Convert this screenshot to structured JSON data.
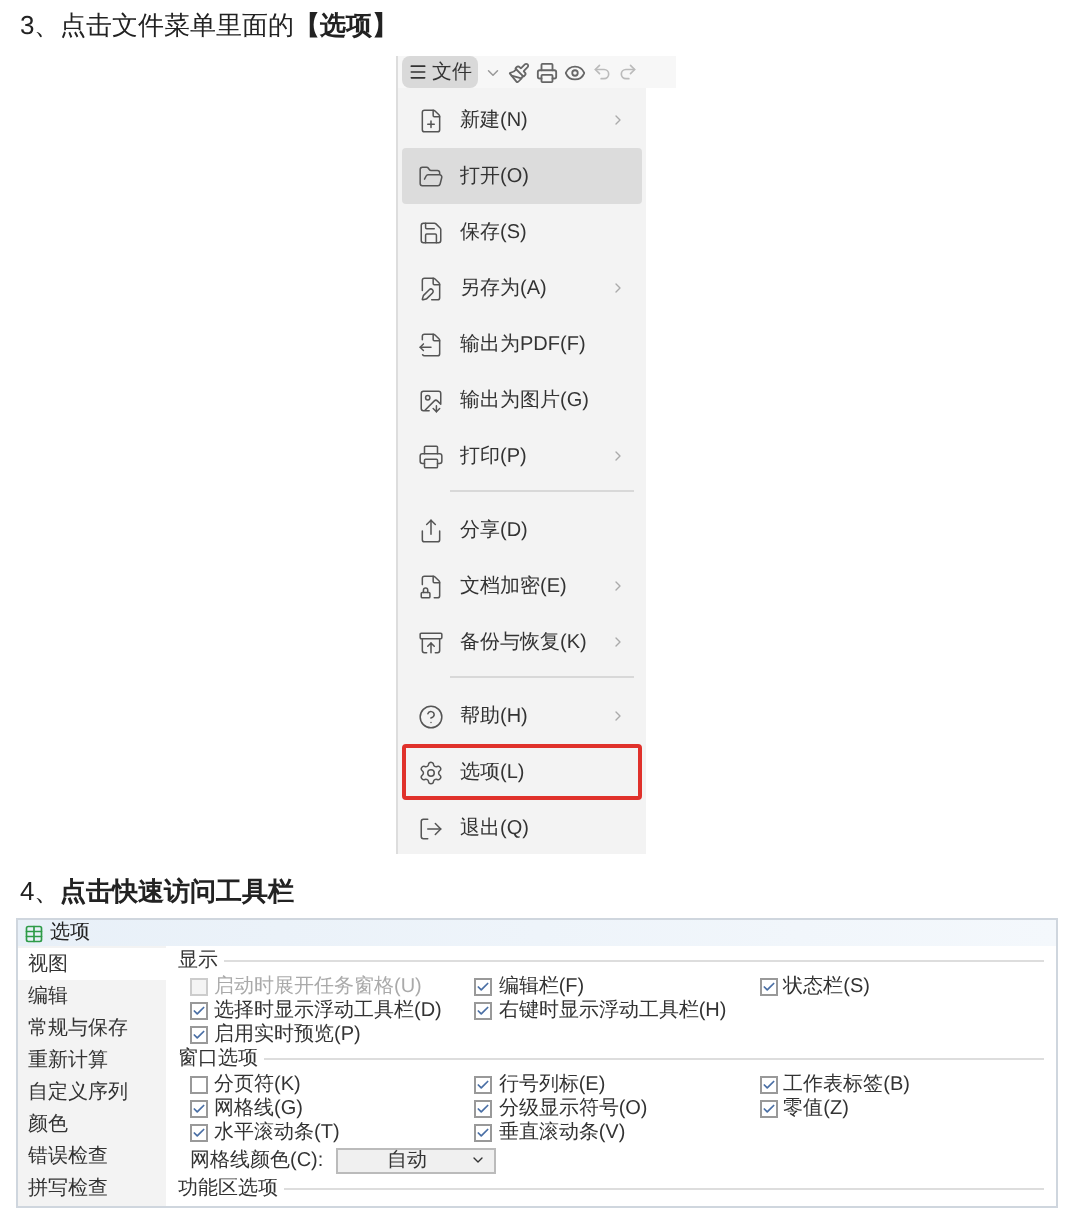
{
  "step_3": {
    "heading": "3、点击文件菜单里面的**【选项】**",
    "screenshot": {
      "toolbar": {
        "file_button": "文件"
      },
      "menu": [
        {
          "label": "新建(N)",
          "submenu": true,
          "selected": false,
          "highlighted": false,
          "divider_after": false
        },
        {
          "label": "打开(O)",
          "submenu": false,
          "selected": true,
          "highlighted": false,
          "divider_after": false
        },
        {
          "label": "保存(S)",
          "submenu": false,
          "selected": false,
          "highlighted": false,
          "divider_after": false
        },
        {
          "label": "另存为(A)",
          "submenu": true,
          "selected": false,
          "highlighted": false,
          "divider_after": false
        },
        {
          "label": "输出为PDF(F)",
          "submenu": false,
          "selected": false,
          "highlighted": false,
          "divider_after": false
        },
        {
          "label": "输出为图片(G)",
          "submenu": false,
          "selected": false,
          "highlighted": false,
          "divider_after": false
        },
        {
          "label": "打印(P)",
          "submenu": true,
          "selected": false,
          "highlighted": false,
          "divider_after": true
        },
        {
          "label": "分享(D)",
          "submenu": false,
          "selected": false,
          "highlighted": false,
          "divider_after": false
        },
        {
          "label": "文档加密(E)",
          "submenu": true,
          "selected": false,
          "highlighted": false,
          "divider_after": false
        },
        {
          "label": "备份与恢复(K)",
          "submenu": true,
          "selected": false,
          "highlighted": false,
          "divider_after": true
        },
        {
          "label": "帮助(H)",
          "submenu": true,
          "selected": false,
          "highlighted": false,
          "divider_after": false
        },
        {
          "label": "选项(L)",
          "submenu": false,
          "selected": false,
          "highlighted": true,
          "divider_after": false
        },
        {
          "label": "退出(Q)",
          "submenu": false,
          "selected": false,
          "highlighted": false,
          "divider_after": false
        }
      ]
    }
  },
  "step_4": {
    "heading": "4、**点击快速访问工具栏**",
    "dialog": {
      "title": "选项",
      "sidebar": [
        {
          "label": "视图",
          "selected": true
        },
        {
          "label": "编辑",
          "selected": false
        },
        {
          "label": "常规与保存",
          "selected": false
        },
        {
          "label": "重新计算",
          "selected": false
        },
        {
          "label": "自定义序列",
          "selected": false
        },
        {
          "label": "颜色",
          "selected": false
        },
        {
          "label": "错误检查",
          "selected": false
        },
        {
          "label": "拼写检查",
          "selected": false
        }
      ],
      "sections": [
        {
          "title": "显示",
          "rows": [
            [
              {
                "label": "启动时展开任务窗格(U)",
                "checked": false,
                "disabled": true
              },
              {
                "label": "编辑栏(F)",
                "checked": true,
                "disabled": false
              },
              {
                "label": "状态栏(S)",
                "checked": true,
                "disabled": false
              }
            ],
            [
              {
                "label": "选择时显示浮动工具栏(D)",
                "checked": true,
                "disabled": false
              },
              {
                "label": "右键时显示浮动工具栏(H)",
                "checked": true,
                "disabled": false
              }
            ],
            [
              {
                "label": "启用实时预览(P)",
                "checked": true,
                "disabled": false
              }
            ]
          ]
        },
        {
          "title": "窗口选项",
          "rows": [
            [
              {
                "label": "分页符(K)",
                "checked": false,
                "disabled": false
              },
              {
                "label": "行号列标(E)",
                "checked": true,
                "disabled": false
              },
              {
                "label": "工作表标签(B)",
                "checked": true,
                "disabled": false
              }
            ],
            [
              {
                "label": "网格线(G)",
                "checked": true,
                "disabled": false
              },
              {
                "label": "分级显示符号(O)",
                "checked": true,
                "disabled": false
              },
              {
                "label": "零值(Z)",
                "checked": true,
                "disabled": false
              }
            ],
            [
              {
                "label": "水平滚动条(T)",
                "checked": true,
                "disabled": false
              },
              {
                "label": "垂直滚动条(V)",
                "checked": true,
                "disabled": false
              }
            ]
          ],
          "color_setting": {
            "label": "网格线颜色(C):",
            "value": "自动"
          }
        },
        {
          "title": "功能区选项"
        }
      ]
    }
  }
}
